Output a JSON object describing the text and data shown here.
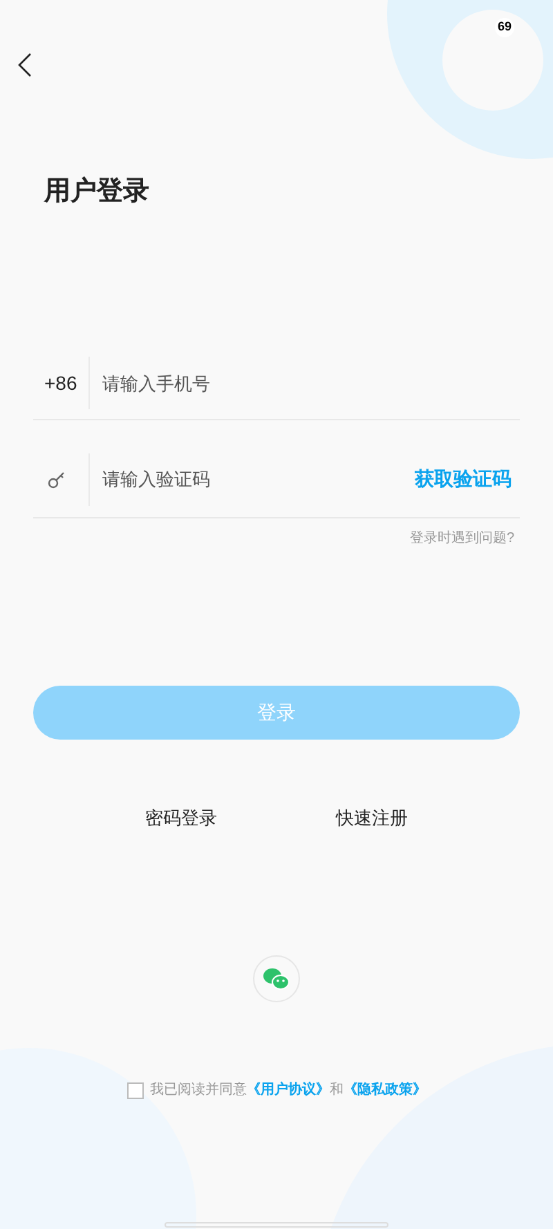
{
  "status_bar": {
    "battery": "69"
  },
  "title": "用户登录",
  "phone": {
    "prefix": "+86",
    "placeholder": "请输入手机号"
  },
  "code": {
    "placeholder": "请输入验证码",
    "action": "获取验证码"
  },
  "help_link": "登录时遇到问题?",
  "login_button": {
    "label": "登录",
    "disabled": true
  },
  "alt_links": [
    "密码登录",
    "快速注册"
  ],
  "agreement": {
    "checked": false,
    "text": "我已阅读并同意",
    "link_1": "《用户协议》",
    "joiner": "和",
    "link_2": "《隐私政策》"
  }
}
